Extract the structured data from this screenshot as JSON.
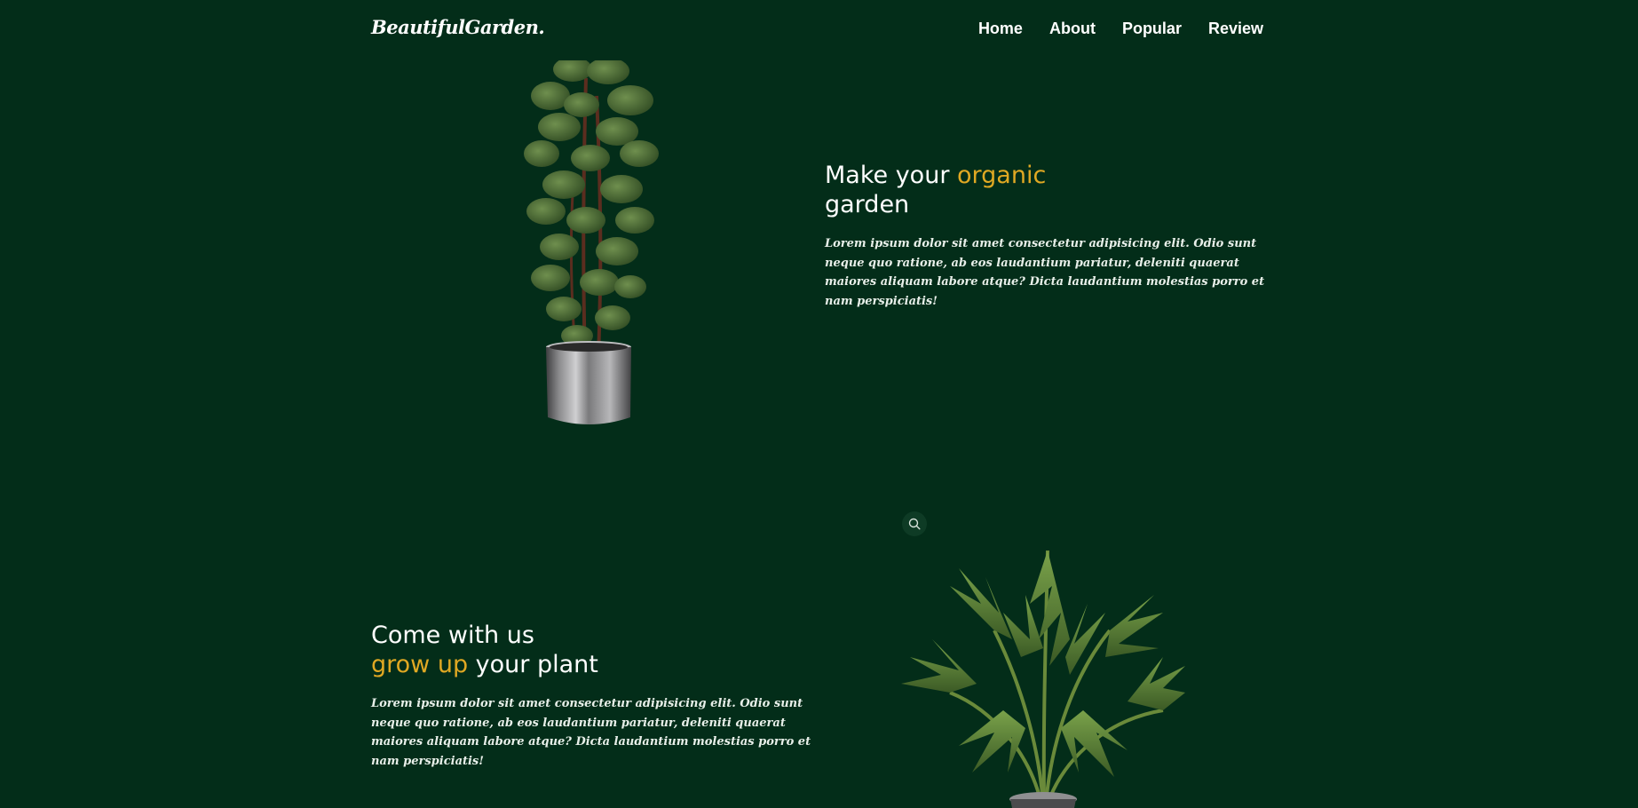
{
  "brand": {
    "logo_text": "BeautifulGarden."
  },
  "nav": {
    "items": [
      {
        "label": "Home"
      },
      {
        "label": "About"
      },
      {
        "label": "Popular"
      },
      {
        "label": "Review"
      }
    ]
  },
  "hero": {
    "title_part1": "Make your ",
    "title_accent": "organic",
    "title_part2": "garden",
    "description": "Lorem ipsum dolor sit amet consectetur adipisicing elit. Odio sunt neque quo ratione, ab eos laudantium pariatur, deleniti quaerat maiores aliquam labore atque? Dicta laudantium molestias porro et nam perspiciatis!"
  },
  "about": {
    "title_line1": "Come with us",
    "title_accent": "grow up",
    "title_part2": " your plant",
    "description": "Lorem ipsum dolor sit amet consectetur adipisicing elit. Odio sunt neque quo ratione, ab eos laudantium pariatur, deleniti quaerat maiores aliquam labore atque? Dicta laudantium molestias porro et nam perspiciatis!"
  },
  "images": {
    "hero_plant": "fiddle-leaf-fig-in-silver-pot",
    "about_plant": "areca-palm-in-pot"
  },
  "icons": {
    "search": "search-icon"
  },
  "colors": {
    "background": "#032d19",
    "accent": "#e0a823",
    "text": "#ffffff"
  }
}
